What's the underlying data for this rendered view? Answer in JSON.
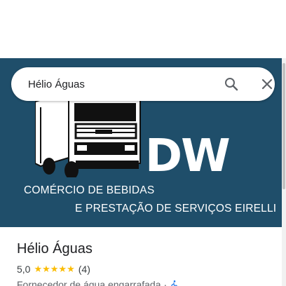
{
  "search": {
    "value": "Hélio Águas",
    "search_icon": "search-icon",
    "close_icon": "close-icon"
  },
  "hero": {
    "logo": "DW",
    "line1": "COMÉRCIO DE BEBIDAS",
    "line2": "E PRESTAÇÃO DE SERVIÇOS EIRELLI"
  },
  "place": {
    "title": "Hélio Águas",
    "rating": "5,0",
    "stars": "★★★★★",
    "reviews": "(4)",
    "category": "Fornecedor de água engarrafada",
    "separator": "·",
    "accessibility_icon": "wheelchair-icon"
  },
  "colors": {
    "hero_bg": "#1f4e6a",
    "star": "#fbbc04",
    "accessibility": "#1a73e8"
  }
}
